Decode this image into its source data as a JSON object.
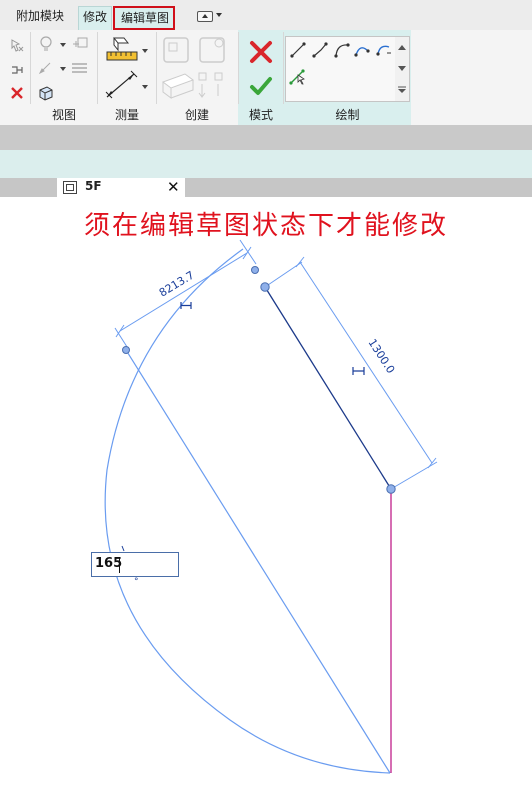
{
  "ribbon_tabs": [
    {
      "label": "附加模块"
    },
    {
      "label": "修改"
    },
    {
      "label": "编辑草图"
    }
  ],
  "panels": {
    "view": "视图",
    "measure": "测量",
    "create": "创建",
    "mode": "模式",
    "draw": "绘制"
  },
  "view_tab": {
    "label": "5F",
    "close": "✕"
  },
  "canvas": {
    "notice": "须在编辑草图状态下才能修改",
    "dim_left": "8213.7",
    "dim_right": "1300.0",
    "input_value": "165"
  },
  "colors": {
    "notice": "#e0121e",
    "sketch_line": "#6a9cf0",
    "selected_line": "#1c3a8a",
    "magenta_line": "#c0208a",
    "ribbon_active": "#d9efee",
    "highlight_box": "#d0101a"
  },
  "icons": {
    "cancel": "x-red-icon",
    "finish": "check-green-icon"
  }
}
